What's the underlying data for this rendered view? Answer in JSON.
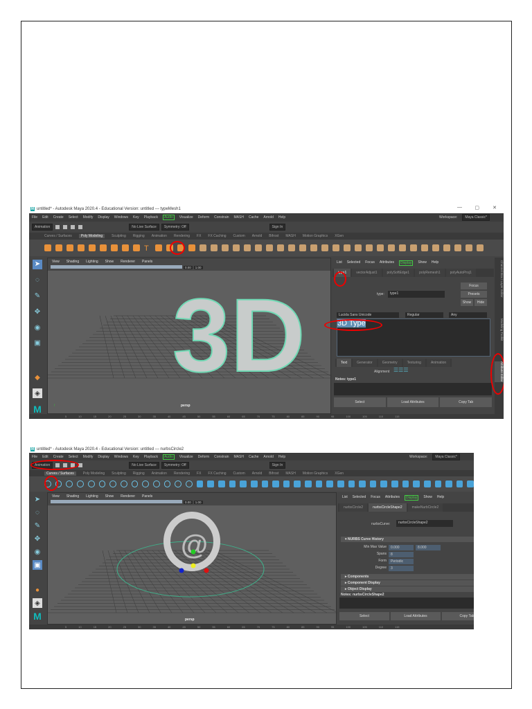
{
  "common": {
    "menus": [
      "File",
      "Edit",
      "Create",
      "Select",
      "Modify",
      "Display",
      "Windows",
      "Key",
      "Playback",
      "Audio",
      "Visualize",
      "Deform",
      "Constrain",
      "MASH",
      "Cache",
      "Arnold",
      "Help"
    ],
    "active_menu": "Audio",
    "workspace_label": "Workspace:",
    "workspace_value": "Maya Classic*",
    "mode": "Animation",
    "live_surface": "No Live Surface",
    "symmetry": "Symmetry: Off",
    "sign_in": "Sign In",
    "shelf_tabs": [
      "Curves / Surfaces",
      "Poly Modeling",
      "Sculpting",
      "Rigging",
      "Animation",
      "Rendering",
      "FX",
      "FX Caching",
      "Custom",
      "Arnold",
      "Bifrost",
      "MASH",
      "Motion Graphics",
      "XGen"
    ],
    "viewport_menus": [
      "View",
      "Shading",
      "Lighting",
      "Show",
      "Renderer",
      "Panels"
    ],
    "vp_value1": "0.00",
    "vp_value2": "1.00",
    "camera": "persp",
    "ae_menus": [
      "List",
      "Selected",
      "Focus",
      "Attributes",
      "Display",
      "Show",
      "Help"
    ],
    "bottom_buttons": [
      "Select",
      "Load Attributes",
      "Copy Tab"
    ],
    "ticks": [
      "5",
      "10",
      "15",
      "20",
      "25",
      "30",
      "35",
      "40",
      "45",
      "50",
      "55",
      "60",
      "65",
      "70",
      "75",
      "80",
      "85",
      "90",
      "95",
      "100",
      "105",
      "110",
      "115"
    ]
  },
  "shot1": {
    "title": "untitled* - Autodesk Maya 2020.4 - Educational Version: untitled  ---  typeMesh1",
    "active_shelf": "Poly Modeling",
    "ae_tabs": [
      "type1",
      "vectorAdjust1",
      "polySoftEdge1",
      "polyRemesh1",
      "polyAutoProj1"
    ],
    "type_label": "type:",
    "type_value": "type1",
    "buttons": [
      "Focus",
      "Presets",
      "Show",
      "Hide"
    ],
    "font": "Lucida Sans Unicode",
    "style": "Regular",
    "script": "Any",
    "text": "3D Type",
    "sub_tabs": [
      "Text",
      "Generator",
      "Geometry",
      "Texturing",
      "Animation"
    ],
    "alignment_label": "Alignment",
    "notes": "Notes:  type1",
    "side_tabs": [
      "Channel Box / Layer Editor",
      "Modeling Toolkit",
      "Attribute Editor"
    ],
    "model_text": "3D"
  },
  "shot2": {
    "title": "untitled* - Autodesk Maya 2020.4 - Educational Version: untitled  ---  nurbsCircle2",
    "active_shelf": "Curves / Surfaces",
    "ae_tabs": [
      "nurbsCircle2",
      "nurbsCircleShape2",
      "makeNurbCircle2"
    ],
    "curve_label": "nurbsCurve:",
    "curve_value": "nurbsCircleShape2",
    "section": "NURBS Curve History",
    "rows": [
      {
        "label": "Min Max Value",
        "v1": "0.000",
        "v2": "8.000"
      },
      {
        "label": "Spans",
        "v1": "8"
      },
      {
        "label": "Form",
        "v1": "Periodic"
      },
      {
        "label": "Degree",
        "v1": "3"
      }
    ],
    "collapsed": [
      "Components",
      "Component Display",
      "Object Display"
    ],
    "notes": "Notes:  nurbsCircleShape2",
    "model_text": "@"
  }
}
